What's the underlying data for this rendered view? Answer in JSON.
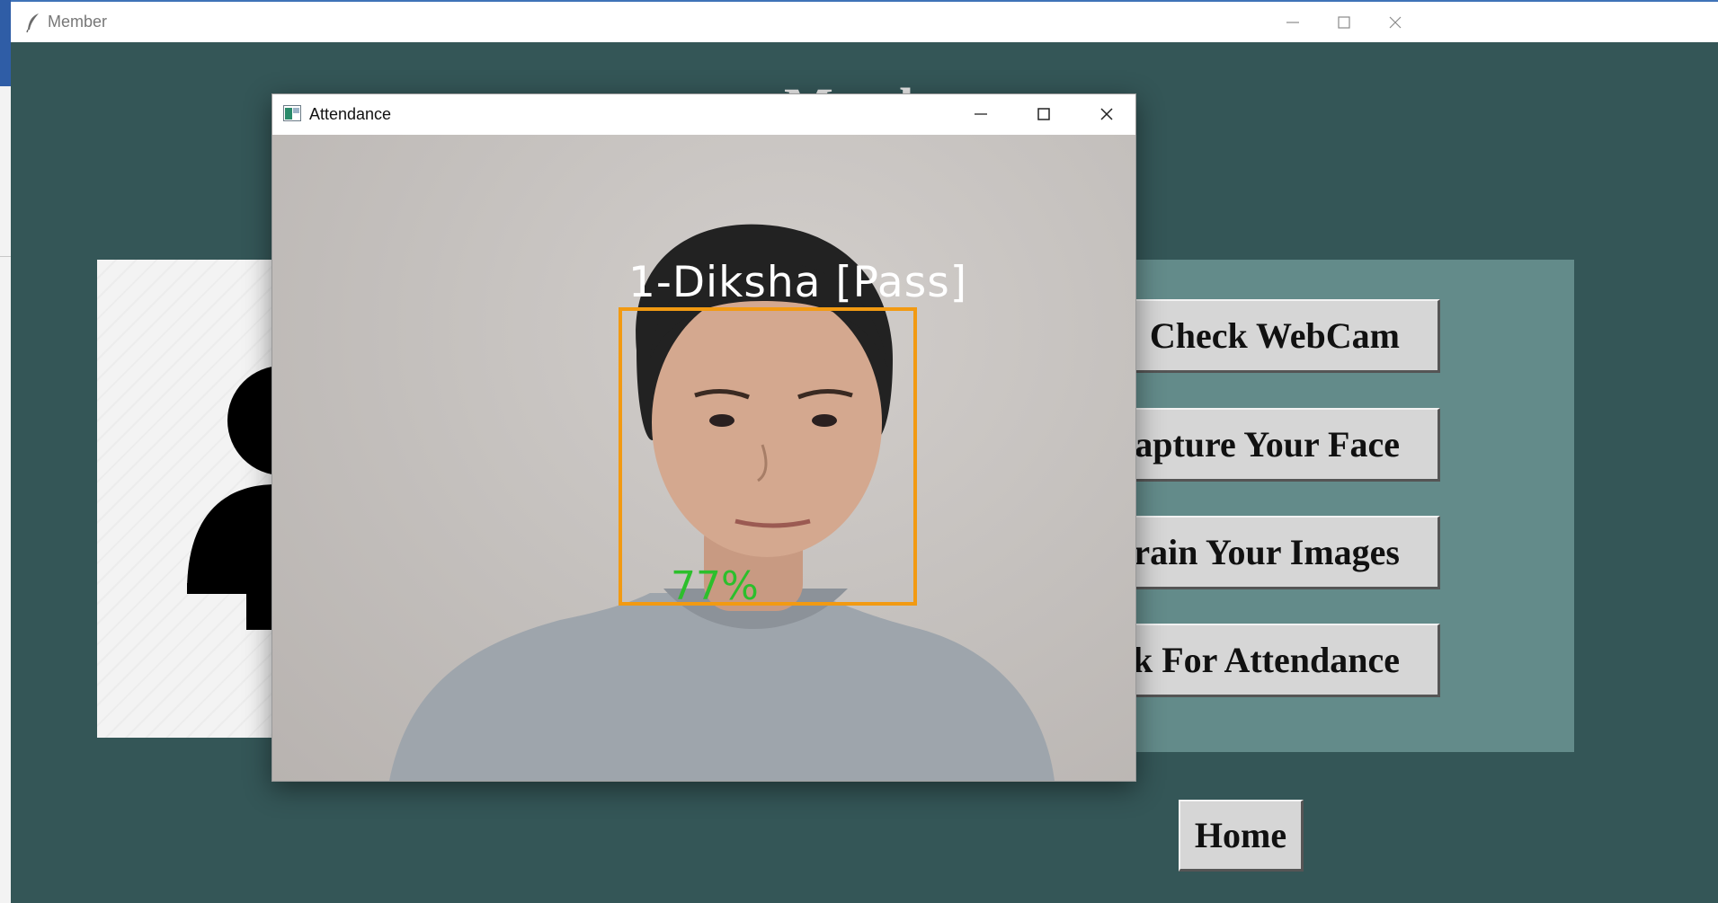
{
  "main_window": {
    "title": "Member",
    "heading": "Member",
    "buttons": {
      "check_webcam": "Check WebCam",
      "capture_face": "Capture Your Face",
      "train_images": "Train Your Images",
      "attendance": "Check For Attendance",
      "home": "Home"
    }
  },
  "attendance_window": {
    "title": "Attendance",
    "face_label": "1-Diksha [Pass]",
    "confidence": "77%"
  },
  "colors": {
    "background": "#345657",
    "panel": "#638b8a",
    "button": "#d6d6d6",
    "face_box": "#f29a12",
    "confidence_text": "#2cbf2c"
  }
}
